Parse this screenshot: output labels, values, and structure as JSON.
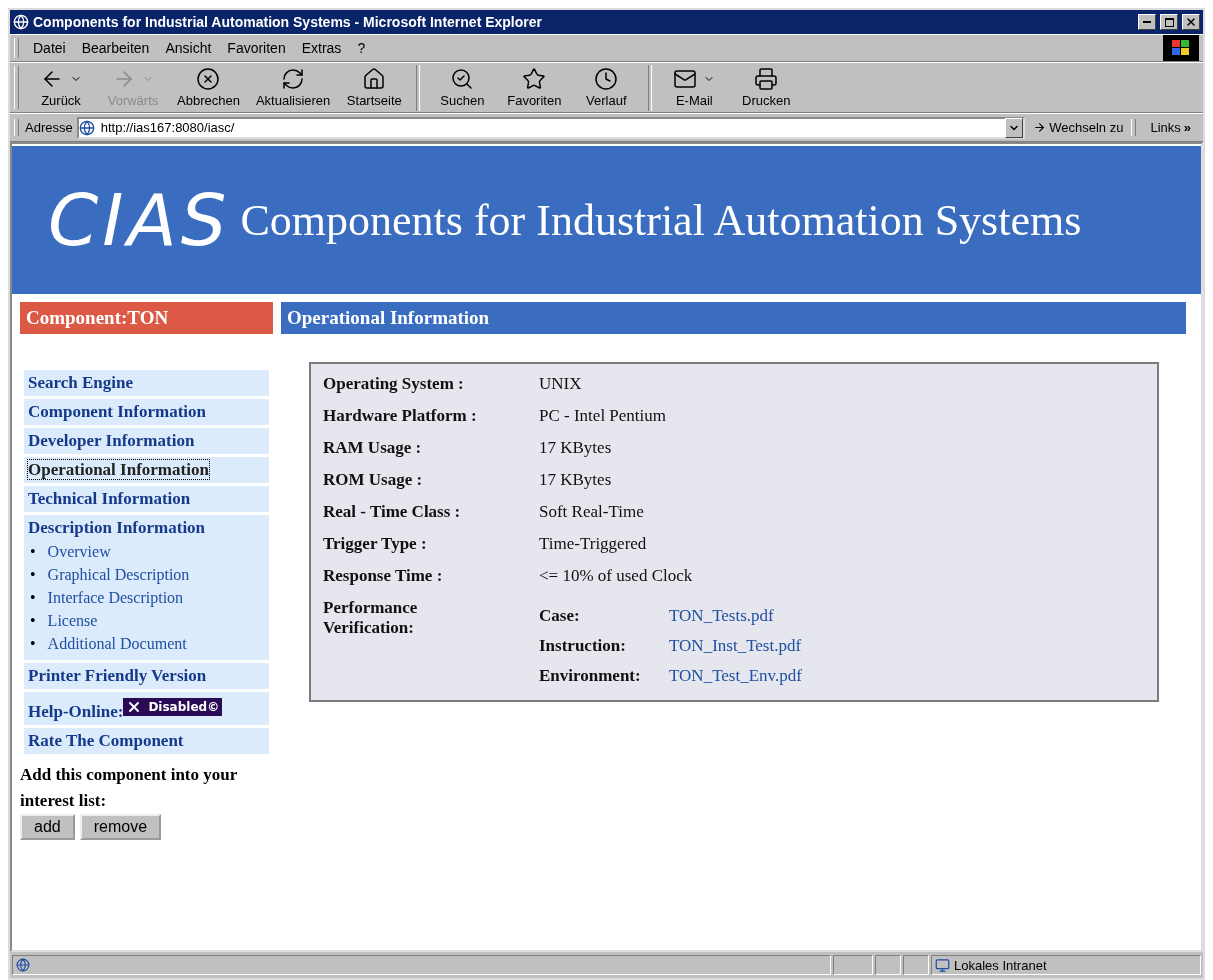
{
  "window": {
    "title": "Components for Industrial Automation Systems - Microsoft Internet Explorer"
  },
  "menu": [
    "Datei",
    "Bearbeiten",
    "Ansicht",
    "Favoriten",
    "Extras",
    "?"
  ],
  "toolbar": [
    {
      "label": "Zurück",
      "disabled": false,
      "dropdown": true
    },
    {
      "label": "Vorwärts",
      "disabled": true,
      "dropdown": true
    },
    {
      "label": "Abbrechen",
      "disabled": false,
      "dropdown": false
    },
    {
      "label": "Aktualisieren",
      "disabled": false,
      "dropdown": false
    },
    {
      "label": "Startseite",
      "disabled": false,
      "dropdown": false
    },
    {
      "label": "Suchen",
      "disabled": false,
      "dropdown": false
    },
    {
      "label": "Favoriten",
      "disabled": false,
      "dropdown": false
    },
    {
      "label": "Verlauf",
      "disabled": false,
      "dropdown": false
    },
    {
      "label": "E-Mail",
      "disabled": false,
      "dropdown": true
    },
    {
      "label": "Drucken",
      "disabled": false,
      "dropdown": false
    }
  ],
  "address": {
    "label": "Adresse",
    "url": "http://ias167:8080/iasc/",
    "go": "Wechseln zu",
    "links": "Links",
    "more": "»"
  },
  "banner": {
    "logo": "CIAS",
    "title": "Components for Industrial Automation Systems"
  },
  "sidebar": {
    "heading": "Component:TON",
    "items": [
      {
        "label": "Search Engine",
        "selected": false
      },
      {
        "label": "Component Information",
        "selected": false
      },
      {
        "label": "Developer Information",
        "selected": false
      },
      {
        "label": "Operational Information",
        "selected": true
      },
      {
        "label": "Technical Information",
        "selected": false
      },
      {
        "label": "Description Information",
        "selected": false,
        "children": [
          {
            "marker": "•",
            "label": "Overview"
          },
          {
            "marker": "•",
            "label": "Graphical Description"
          },
          {
            "marker": "•",
            "label": "Interface Description"
          },
          {
            "marker": "•",
            "label": "License"
          },
          {
            "marker": "•",
            "label": "Additional Document"
          }
        ]
      },
      {
        "label": "Printer Friendly Version",
        "selected": false
      }
    ],
    "help": {
      "label": "Help-Online:",
      "badge": "Disabled©"
    },
    "rate": "Rate The Component",
    "prompt": "Add this component into your interest list:",
    "buttons": [
      "add",
      "remove"
    ]
  },
  "main": {
    "heading": "Operational Information",
    "rows": [
      {
        "label": "Operating System :",
        "value": "UNIX"
      },
      {
        "label": "Hardware Platform :",
        "value": "PC - Intel Pentium"
      },
      {
        "label": "RAM Usage :",
        "value": "17 KBytes"
      },
      {
        "label": "ROM Usage :",
        "value": "17 KBytes"
      },
      {
        "label": "Real - Time Class :",
        "value": "Soft Real-Time"
      },
      {
        "label": "Trigger Type :",
        "value": "Time-Triggered"
      },
      {
        "label": "Response Time :",
        "value": "<= 10% of used Clock"
      }
    ],
    "verification": {
      "label": "Performance Verification:",
      "files": [
        {
          "label": "Case:",
          "link": "TON_Tests.pdf"
        },
        {
          "label": "Instruction:",
          "link": "TON_Inst_Test.pdf"
        },
        {
          "label": "Environment:",
          "link": "TON_Test_Env.pdf"
        }
      ]
    }
  },
  "status_bar": {
    "zone": "Lokales Intranet"
  }
}
